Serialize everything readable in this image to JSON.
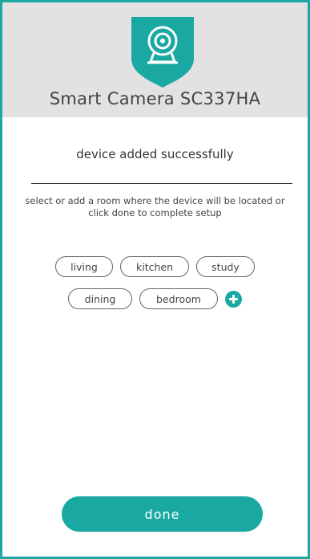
{
  "app": {
    "title": "Smart Camera SC337HA",
    "logo_icon": "camera-shield-icon",
    "accent_color": "#1aa9a2"
  },
  "status": {
    "message": "device added successfully"
  },
  "instructions": {
    "text": "select or add a room where the device will be located or click done to complete setup"
  },
  "rooms": {
    "row1": [
      "living",
      "kitchen",
      "study"
    ],
    "row2": [
      "dining",
      "bedroom"
    ],
    "add_icon": "plus-circle-icon"
  },
  "actions": {
    "done_label": "done"
  }
}
